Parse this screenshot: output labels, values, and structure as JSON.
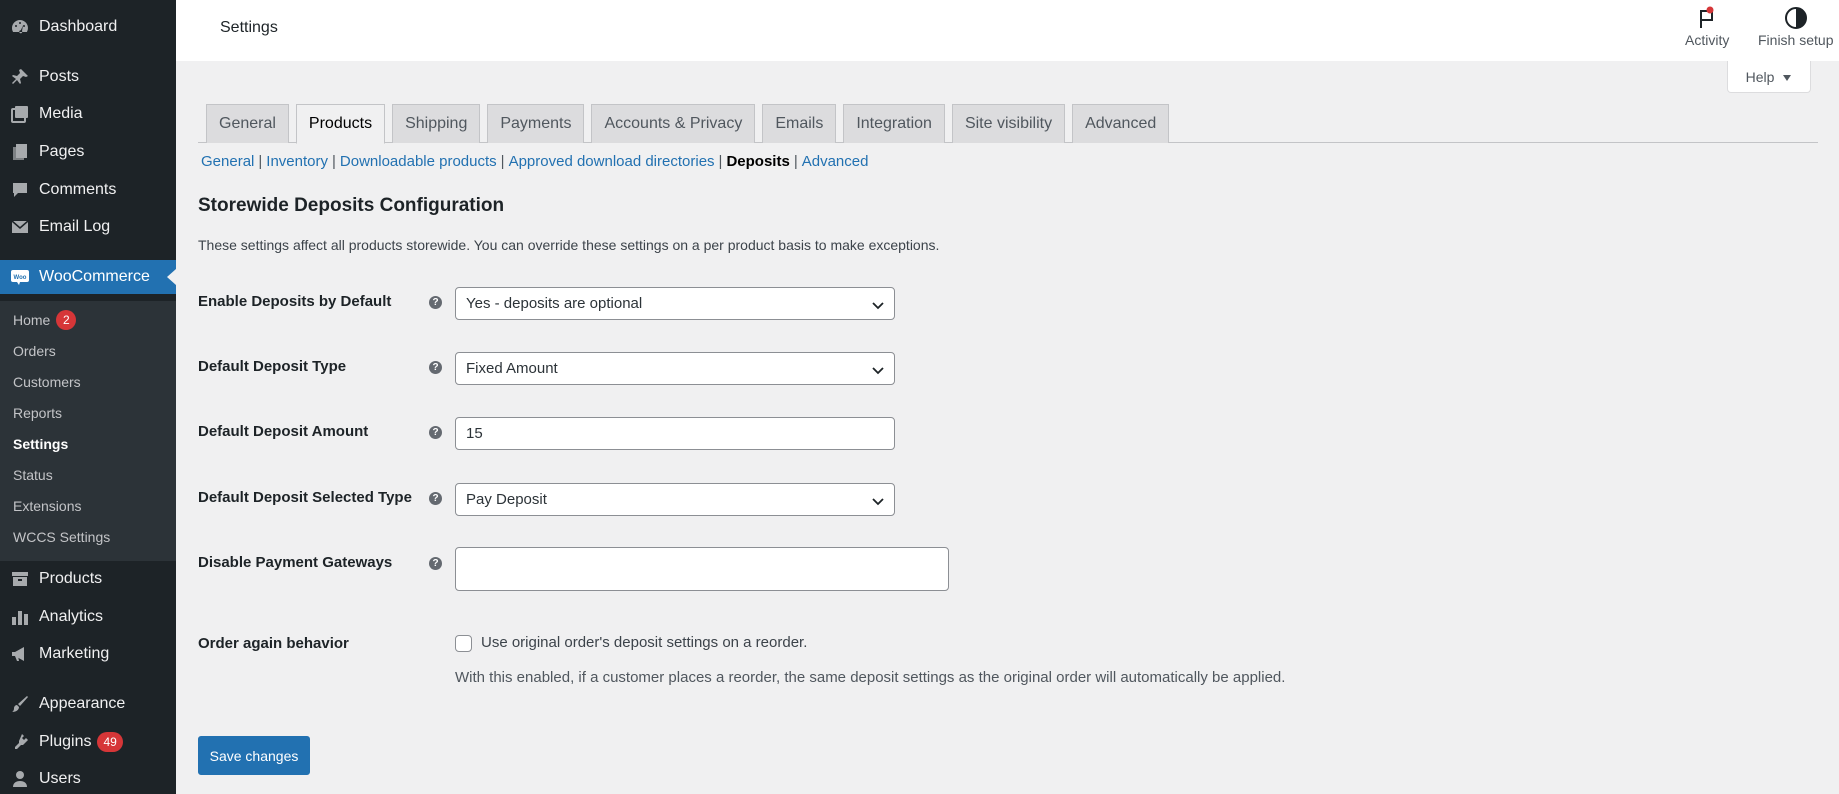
{
  "sidebar": {
    "dashboard": "Dashboard",
    "posts": "Posts",
    "media": "Media",
    "pages": "Pages",
    "comments": "Comments",
    "email_log": "Email Log",
    "woocommerce": "WooCommerce",
    "woo_sub": {
      "home": "Home",
      "home_badge": "2",
      "orders": "Orders",
      "customers": "Customers",
      "reports": "Reports",
      "settings": "Settings",
      "status": "Status",
      "extensions": "Extensions",
      "wccs": "WCCS Settings"
    },
    "products": "Products",
    "analytics": "Analytics",
    "marketing": "Marketing",
    "appearance": "Appearance",
    "plugins": "Plugins",
    "plugins_badge": "49",
    "users": "Users"
  },
  "header": {
    "title": "Settings",
    "activity": "Activity",
    "finish_setup": "Finish setup",
    "help": "Help"
  },
  "tabs": [
    "General",
    "Products",
    "Shipping",
    "Payments",
    "Accounts & Privacy",
    "Emails",
    "Integration",
    "Site visibility",
    "Advanced"
  ],
  "subsections": {
    "general": "General",
    "inventory": "Inventory",
    "downloadable": "Downloadable products",
    "approved_dirs": "Approved download directories",
    "deposits": "Deposits",
    "advanced": "Advanced"
  },
  "section": {
    "title": "Storewide Deposits Configuration",
    "description": "These settings affect all products storewide. You can override these settings on a per product basis to make exceptions."
  },
  "fields": {
    "enable_label": "Enable Deposits by Default",
    "enable_value": "Yes - deposits are optional",
    "type_label": "Default Deposit Type",
    "type_value": "Fixed Amount",
    "amount_label": "Default Deposit Amount",
    "amount_value": "15",
    "selected_label": "Default Deposit Selected Type",
    "selected_value": "Pay Deposit",
    "disable_label": "Disable Payment Gateways",
    "order_again_label": "Order again behavior",
    "order_again_checkbox": "Use original order's deposit settings on a reorder.",
    "order_again_help": "With this enabled, if a customer places a reorder, the same deposit settings as the original order will automatically be applied."
  },
  "save_button": "Save changes",
  "tip_glyph": "?",
  "colors": {
    "sidebar_bg": "#1d2327",
    "accent": "#2271b1",
    "badge": "#d63638"
  }
}
